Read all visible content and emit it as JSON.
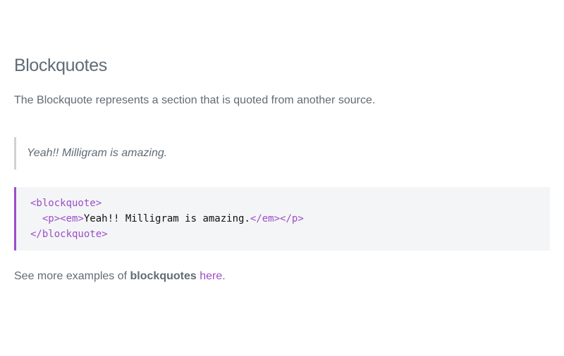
{
  "section": {
    "title": "Blockquotes",
    "intro": "The Blockquote represents a section that is quoted from another source.",
    "quote_text": "Yeah!! Milligram is amazing.",
    "code": {
      "line1_tag": "<blockquote>",
      "line2_indent": "  ",
      "line2_open_p": "<p>",
      "line2_open_em": "<em>",
      "line2_text": "Yeah!! Milligram is amazing.",
      "line2_close_em": "</em>",
      "line2_close_p": "</p>",
      "line3_tag": "</blockquote>"
    },
    "more": {
      "prefix": "See more examples of ",
      "bold": "blockquotes",
      "space": " ",
      "link": "here",
      "suffix": "."
    }
  },
  "colors": {
    "text": "#606c76",
    "accent": "#9b4dca",
    "quote_border": "#d1d1d1",
    "code_bg": "#f4f5f6"
  }
}
